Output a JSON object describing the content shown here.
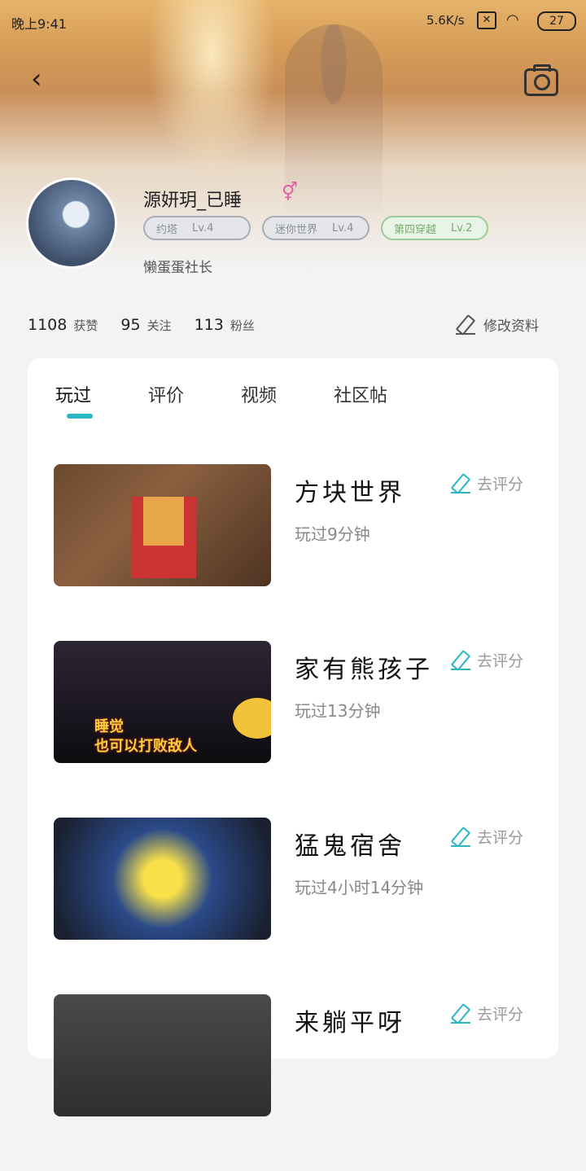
{
  "status_bar": {
    "time": "晚上9:41",
    "speed": "5.6K/s",
    "battery": "27"
  },
  "profile": {
    "username": "源妍玥_已睡",
    "gender_symbol": "⚥",
    "badges": [
      {
        "name": "约塔",
        "level": "Lv.4"
      },
      {
        "name": "迷你世界",
        "level": "Lv.4"
      },
      {
        "name": "第四穿越",
        "level": "Lv.2"
      }
    ],
    "title": "懒蛋蛋社长"
  },
  "stats": {
    "likes_value": "1108",
    "likes_label": "获赞",
    "following_value": "95",
    "following_label": "关注",
    "fans_value": "113",
    "fans_label": "粉丝",
    "edit_label": "修改资料"
  },
  "tabs": [
    "玩过",
    "评价",
    "视频",
    "社区帖"
  ],
  "games": [
    {
      "name": "方块世界",
      "rate_label": "去评分",
      "played": "玩过9分钟",
      "thumb_caption": ""
    },
    {
      "name": "家有熊孩子",
      "rate_label": "去评分",
      "played": "玩过13分钟",
      "thumb_caption": "睡觉\n也可以打败敌人"
    },
    {
      "name": "猛鬼宿舍",
      "rate_label": "去评分",
      "played": "玩过4小时14分钟",
      "thumb_caption": ""
    },
    {
      "name": "来躺平呀",
      "rate_label": "去评分",
      "played": "",
      "thumb_caption": ""
    }
  ]
}
